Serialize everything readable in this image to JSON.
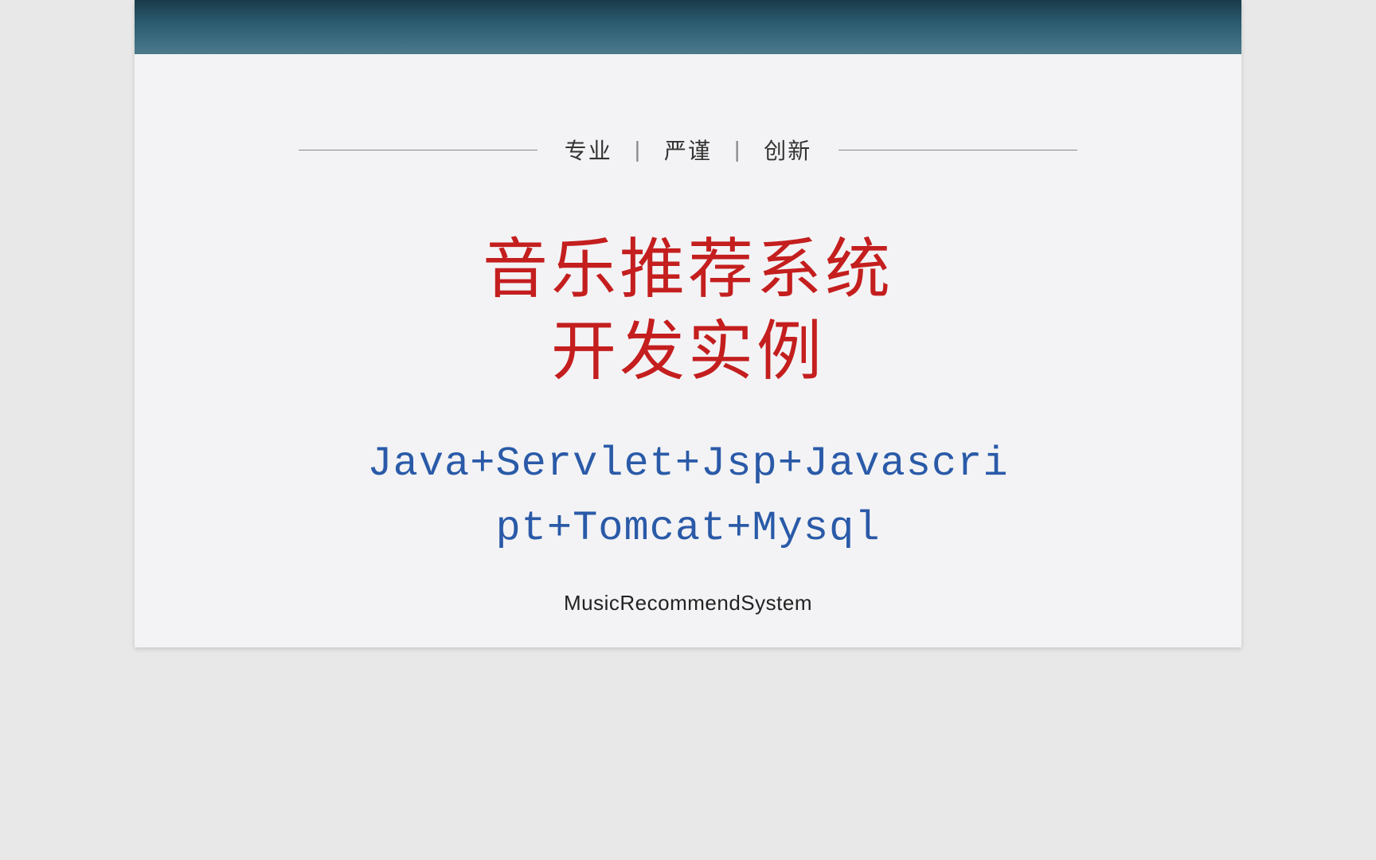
{
  "tagline": {
    "items": [
      "专业",
      "严谨",
      "创新"
    ]
  },
  "main_title": {
    "line1": "音乐推荐系统",
    "line2": "开发实例"
  },
  "tech_stack": {
    "line1": "Java+Servlet+Jsp+Javascri",
    "line2": "pt+Tomcat+Mysql"
  },
  "project_name": "MusicRecommendSystem"
}
